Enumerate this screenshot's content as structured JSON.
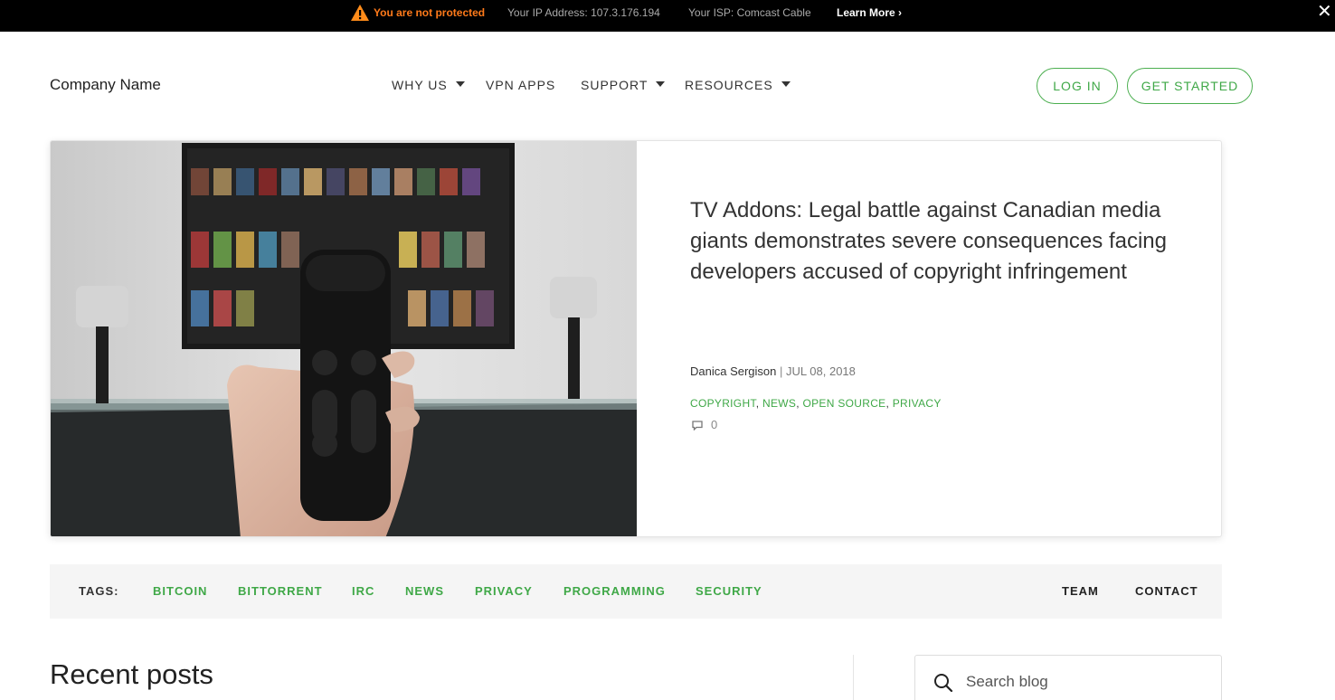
{
  "alert_bar": {
    "status": "You are not protected",
    "ip": "Your IP Address: 107.3.176.194",
    "isp": "Your ISP: Comcast Cable",
    "learn_more": "Learn More ›",
    "close": "✕",
    "status_color": "#ff7a1a"
  },
  "header": {
    "brand": "Company Name",
    "nav": [
      {
        "label": "WHY US",
        "dropdown": true
      },
      {
        "label": "VPN APPS",
        "dropdown": false
      },
      {
        "label": "SUPPORT",
        "dropdown": true
      },
      {
        "label": "RESOURCES",
        "dropdown": true
      }
    ],
    "login": "LOG IN",
    "get_started": "GET STARTED",
    "accent": "#3fa847"
  },
  "featured": {
    "title": "TV Addons: Legal battle against Canadian media giants demonstrates severe consequences facing developers accused of copyright infringement",
    "author": "Danica Sergison",
    "separator": "|",
    "date": "JUL 08, 2018",
    "tags": [
      "COPYRIGHT",
      "NEWS",
      "OPEN SOURCE",
      "PRIVACY"
    ],
    "comments": "0",
    "image_icon": "tv-remote-photo"
  },
  "tags_bar": {
    "label": "TAGS:",
    "tags": [
      "BITCOIN",
      "BITTORRENT",
      "IRC",
      "NEWS",
      "PRIVACY",
      "PROGRAMMING",
      "SECURITY"
    ],
    "links": [
      "TEAM",
      "CONTACT"
    ]
  },
  "recent": {
    "heading": "Recent posts"
  },
  "search": {
    "placeholder": "Search blog"
  }
}
